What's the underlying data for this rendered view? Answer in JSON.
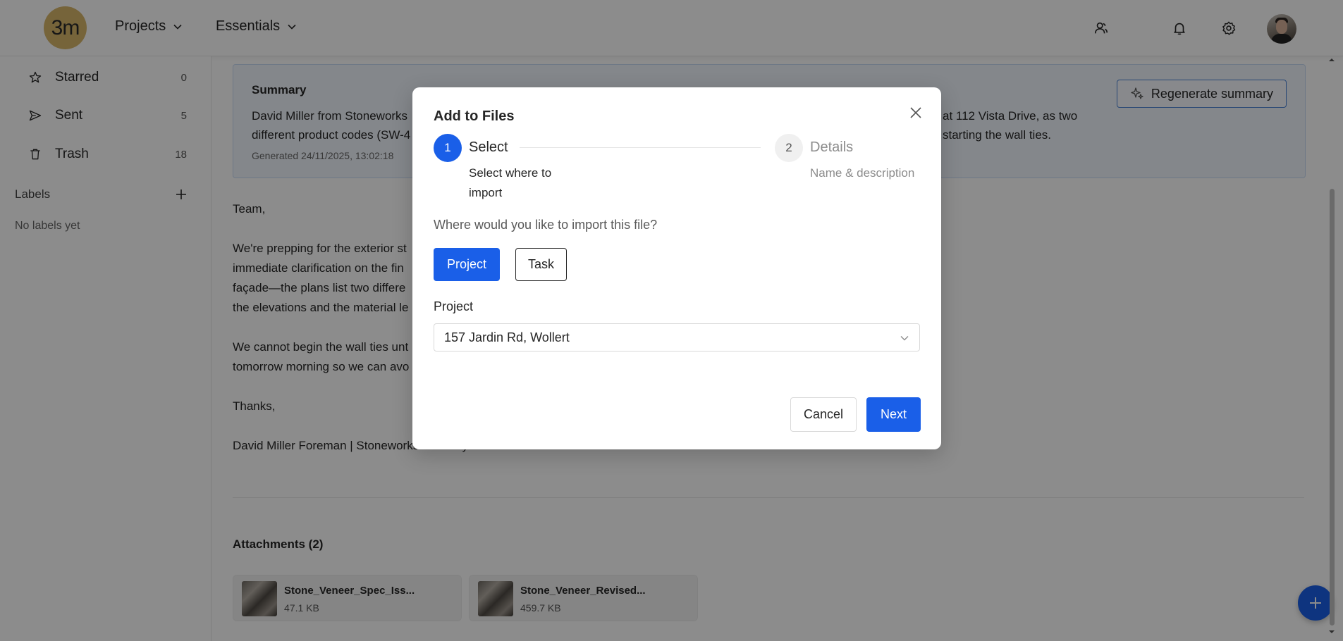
{
  "header": {
    "logo_text": "3m",
    "menus": [
      {
        "label": "Projects"
      },
      {
        "label": "Essentials"
      }
    ],
    "icons": [
      "contacts-icon",
      "bell-icon",
      "gear-icon",
      "avatar"
    ]
  },
  "sidebar": {
    "items": [
      {
        "label": "Starred",
        "count": "0",
        "icon": "star-icon"
      },
      {
        "label": "Sent",
        "count": "5",
        "icon": "send-icon"
      },
      {
        "label": "Trash",
        "count": "18",
        "icon": "trash-icon"
      }
    ],
    "labels_heading": "Labels",
    "no_labels": "No labels yet"
  },
  "summary": {
    "title": "Summary",
    "line1_start": "David Miller from Stoneworks",
    "line1_end": "at 112 Vista Drive, as two",
    "line2_start": "different product codes (SW-4",
    "line2_end": "starting the wall ties.",
    "generated": "Generated 24/11/2025, 13:02:18",
    "regen_label": "Regenerate summary"
  },
  "email": {
    "greeting": "Team,",
    "lines": [
      "We're prepping for the exterior st",
      "immediate clarification on the fin",
      "façade—the plans list two differe",
      "the elevations and the material le"
    ],
    "lines2": [
      "We cannot begin the wall ties unt",
      "tomorrow morning so we can avo"
    ],
    "thanks": "Thanks,",
    "signature": "David Miller Foreman | Stoneworks Masonry"
  },
  "attachments": {
    "heading": "Attachments (2)",
    "items": [
      {
        "name": "Stone_Veneer_Spec_Iss...",
        "size": "47.1 KB"
      },
      {
        "name": "Stone_Veneer_Revised...",
        "size": "459.7 KB"
      }
    ]
  },
  "modal": {
    "title": "Add to Files",
    "steps": [
      {
        "number": "1",
        "title": "Select",
        "desc_line1": "Select where to",
        "desc_line2": "import"
      },
      {
        "number": "2",
        "title": "Details",
        "desc_line1": "Name & description"
      }
    ],
    "question": "Where would you like to import this file?",
    "options": [
      {
        "label": "Project",
        "selected": true
      },
      {
        "label": "Task",
        "selected": false
      }
    ],
    "field_label": "Project",
    "selected_project": "157 Jardin Rd, Wollert",
    "cancel_label": "Cancel",
    "next_label": "Next"
  },
  "colors": {
    "primary": "#1a5fe8",
    "logo": "#d8b66a",
    "summary_bg": "#f1f6fd"
  }
}
